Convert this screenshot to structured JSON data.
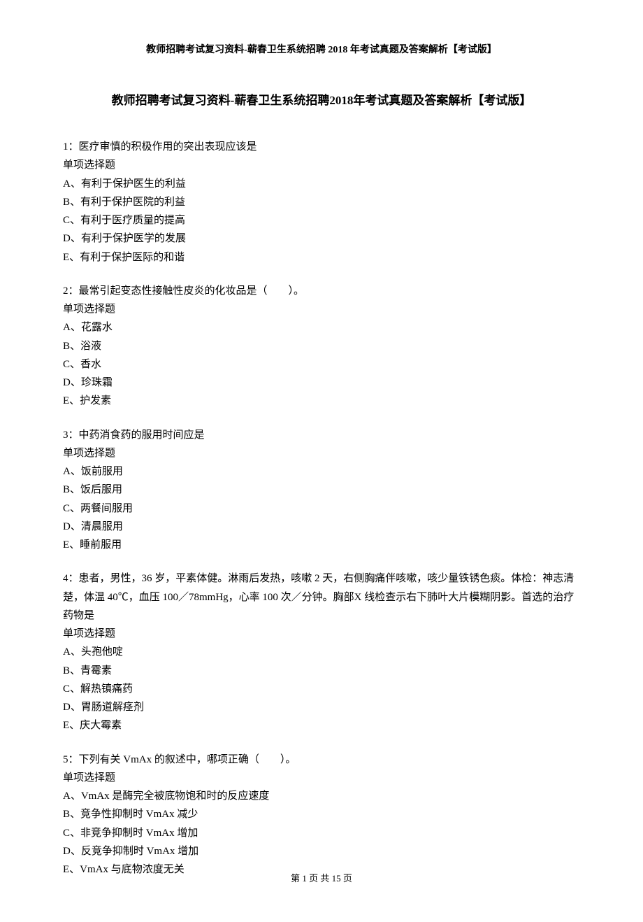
{
  "header": "教师招聘考试复习资料-蕲春卫生系统招聘 2018 年考试真题及答案解析【考试版】",
  "title": "教师招聘考试复习资料-蕲春卫生系统招聘2018年考试真题及答案解析【考试版】",
  "questions": [
    {
      "num": "1：",
      "stem": "医疗审慎的积极作用的突出表现应该是",
      "type": "单项选择题",
      "options": [
        "A、有利于保护医生的利益",
        "B、有利于保护医院的利益",
        "C、有利于医疗质量的提高",
        "D、有利于保护医学的发展",
        "E、有利于保护医际的和谐"
      ]
    },
    {
      "num": "2：",
      "stem": "最常引起变态性接触性皮炎的化妆品是（　　）。",
      "type": "单项选择题",
      "options": [
        "A、花露水",
        "B、浴液",
        "C、香水",
        "D、珍珠霜",
        "E、护发素"
      ]
    },
    {
      "num": "3：",
      "stem": "中药消食药的服用时间应是",
      "type": "单项选择题",
      "options": [
        "A、饭前服用",
        "B、饭后服用",
        "C、两餐间服用",
        "D、清晨服用",
        "E、睡前服用"
      ]
    },
    {
      "num": "4：",
      "stem": "患者，男性，36 岁，平素体健。淋雨后发热，咳嗽 2 天，右侧胸痛伴咳嗽，咳少量铁锈色痰。体检：神志清楚，体温 40℃，血压 100／78mmHg，心率 100 次／分钟。胸部X 线检查示右下肺叶大片模糊阴影。首选的治疗药物是",
      "type": "单项选择题",
      "options": [
        "A、头孢他啶",
        "B、青霉素",
        "C、解热镇痛药",
        "D、胃肠道解痉剂",
        "E、庆大霉素"
      ]
    },
    {
      "num": "5：",
      "stem": "下列有关 VmAx 的叙述中，哪项正确（　　）。",
      "type": "单项选择题",
      "options": [
        "A、VmAx 是酶完全被底物饱和时的反应速度",
        "B、竞争性抑制时 VmAx 减少",
        "C、非竞争抑制时 VmAx 增加",
        "D、反竞争抑制时 VmAx 增加",
        "E、VmAx 与底物浓度无关"
      ]
    }
  ],
  "footer": "第 1 页 共 15 页"
}
